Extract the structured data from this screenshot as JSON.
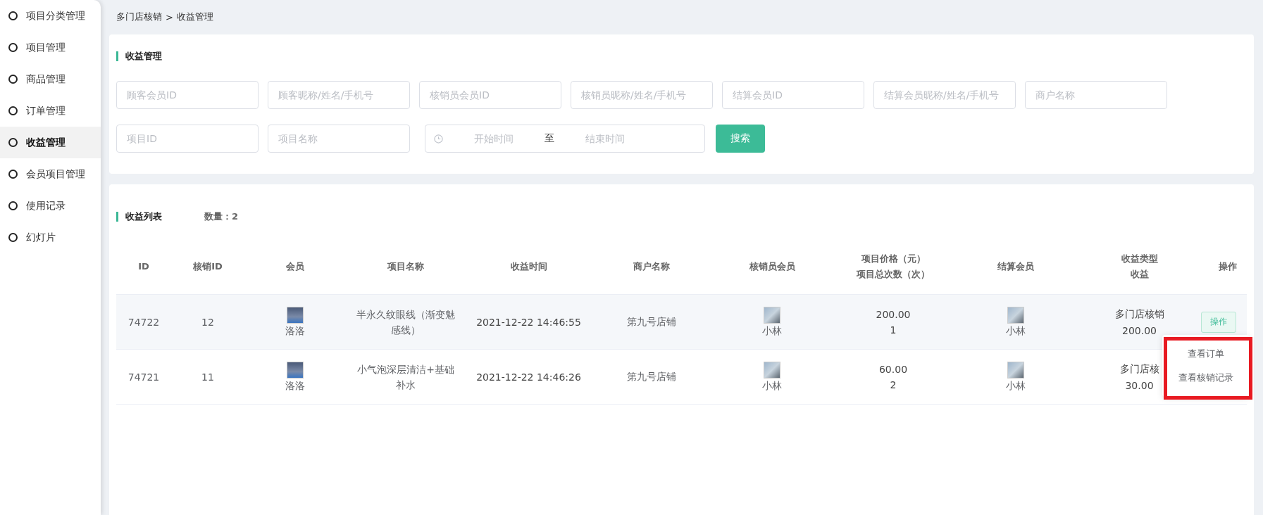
{
  "sidebar": {
    "items": [
      {
        "label": "项目分类管理",
        "selected": false
      },
      {
        "label": "项目管理",
        "selected": false
      },
      {
        "label": "商品管理",
        "selected": false
      },
      {
        "label": "订单管理",
        "selected": false
      },
      {
        "label": "收益管理",
        "selected": true
      },
      {
        "label": "会员项目管理",
        "selected": false
      },
      {
        "label": "使用记录",
        "selected": false
      },
      {
        "label": "幻灯片",
        "selected": false
      }
    ]
  },
  "breadcrumb": {
    "parent": "多门店核销",
    "separator": ">",
    "current": "收益管理"
  },
  "filter": {
    "title": "收益管理",
    "fields": [
      {
        "placeholder": "顾客会员ID"
      },
      {
        "placeholder": "顾客昵称/姓名/手机号"
      },
      {
        "placeholder": "核销员会员ID"
      },
      {
        "placeholder": "核销员昵称/姓名/手机号"
      },
      {
        "placeholder": "结算会员ID"
      },
      {
        "placeholder": "结算会员昵称/姓名/手机号"
      },
      {
        "placeholder": "商户名称"
      },
      {
        "placeholder": "项目ID"
      },
      {
        "placeholder": "项目名称"
      }
    ],
    "date_range": {
      "start_placeholder": "开始时间",
      "separator": "至",
      "end_placeholder": "结束时间"
    },
    "search_button": "搜索"
  },
  "list": {
    "title": "收益列表",
    "count_label": "数量：",
    "count": "2",
    "columns": [
      [
        "ID"
      ],
      [
        "核销ID"
      ],
      [
        "会员"
      ],
      [
        "项目名称"
      ],
      [
        "收益时间"
      ],
      [
        "商户名称"
      ],
      [
        "核销员会员"
      ],
      [
        "项目价格（元）",
        "项目总次数（次）"
      ],
      [
        "结算会员"
      ],
      [
        "收益类型",
        "收益"
      ],
      [
        "操作"
      ]
    ],
    "rows": [
      {
        "id": "74722",
        "verify_id": "12",
        "member": "洛洛",
        "item_name": "半永久纹眼线（渐变魅感线）",
        "time": "2021-12-22 14:46:55",
        "merchant": "第九号店铺",
        "verifier": "小林",
        "price": "200.00",
        "times": "1",
        "settler": "小林",
        "type": "多门店核销",
        "income": "200.00",
        "action": "操作",
        "hovered": true
      },
      {
        "id": "74721",
        "verify_id": "11",
        "member": "洛洛",
        "item_name": "小气泡深层清洁+基础补水",
        "time": "2021-12-22 14:46:26",
        "merchant": "第九号店铺",
        "verifier": "小林",
        "price": "60.00",
        "times": "2",
        "settler": "小林",
        "type": "多门店核",
        "income": "30.00",
        "hovered": false
      }
    ]
  },
  "action_menu": {
    "items": [
      "查看订单",
      "查看核销记录"
    ]
  }
}
